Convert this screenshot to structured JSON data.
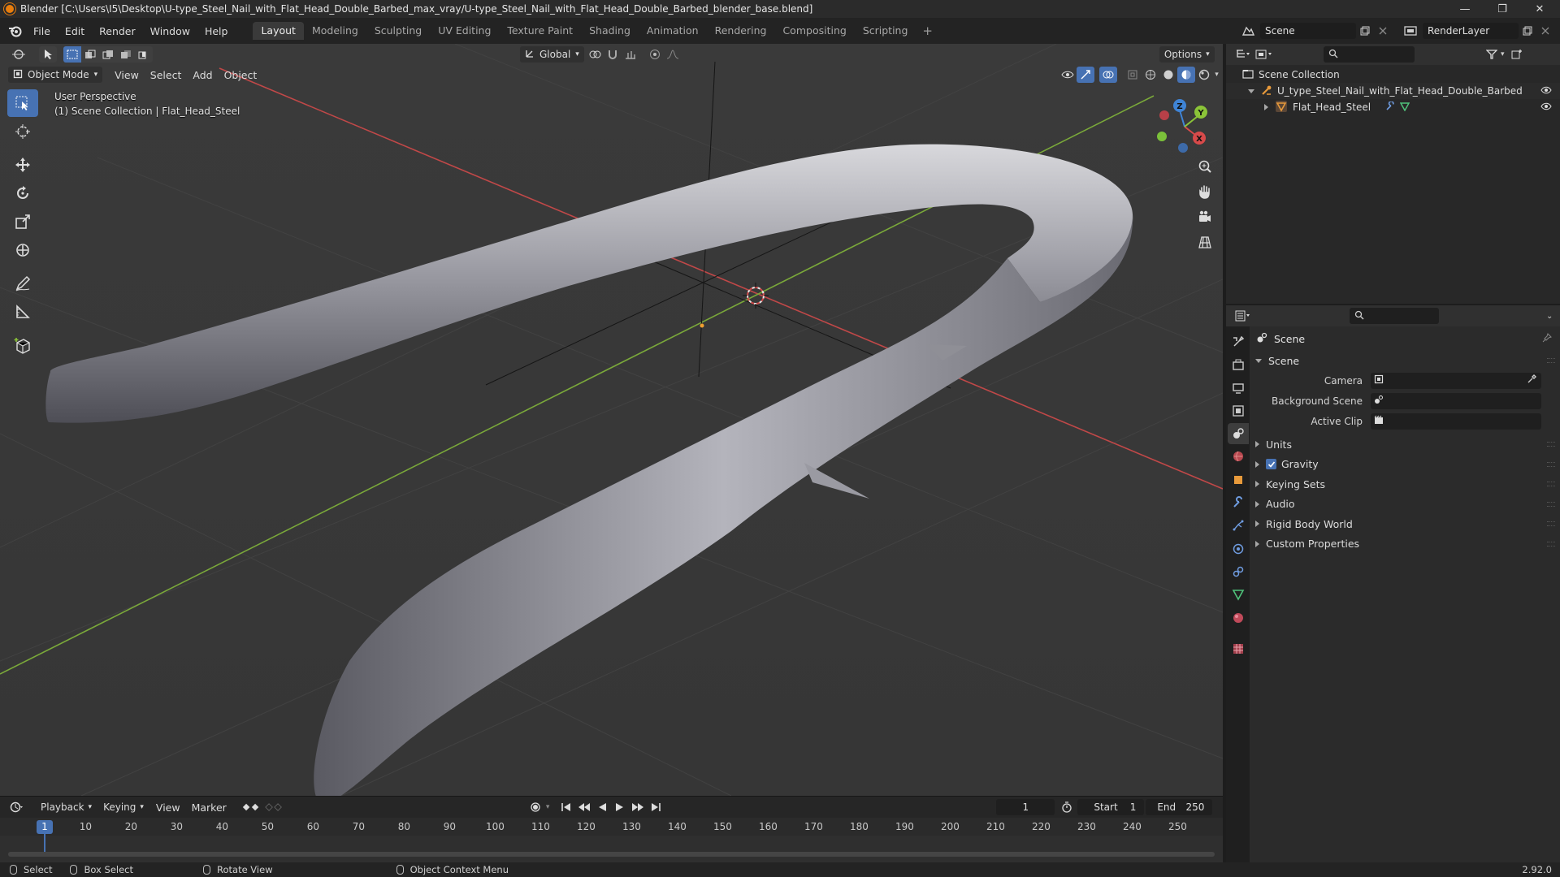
{
  "window": {
    "title": "Blender [C:\\Users\\I5\\Desktop\\U-type_Steel_Nail_with_Flat_Head_Double_Barbed_max_vray/U-type_Steel_Nail_with_Flat_Head_Double_Barbed_blender_base.blend]",
    "minimize": "—",
    "maximize": "❐",
    "close": "✕"
  },
  "menu": {
    "items": [
      "File",
      "Edit",
      "Render",
      "Window",
      "Help"
    ],
    "workspaces": [
      "Layout",
      "Modeling",
      "Sculpting",
      "UV Editing",
      "Texture Paint",
      "Shading",
      "Animation",
      "Rendering",
      "Compositing",
      "Scripting"
    ],
    "active_workspace": "Layout",
    "add_workspace": "+"
  },
  "scene_selector": {
    "scene_name": "Scene",
    "view_layer_name": "RenderLayer"
  },
  "viewport": {
    "transform_orientation": "Global",
    "options_label": "Options",
    "mode": "Object Mode",
    "header_menus": [
      "View",
      "Select",
      "Add",
      "Object"
    ],
    "info_line1": "User Perspective",
    "info_line2": "(1) Scene Collection | Flat_Head_Steel",
    "gizmo": {
      "x": "X",
      "y": "Y",
      "z": "Z"
    },
    "colors": {
      "x_axis": "#d84a4a",
      "y_axis": "#8bc438",
      "z_axis": "#3f84d6",
      "active_tool": "#4772b3"
    }
  },
  "outliner": {
    "root": "Scene Collection",
    "items": [
      {
        "name": "U_type_Steel_Nail_with_Flat_Head_Double_Barbed",
        "icon": "armature-icon"
      },
      {
        "name": "Flat_Head_Steel",
        "icon": "mesh-icon"
      }
    ]
  },
  "properties": {
    "context_title": "Scene",
    "panel_title": "Scene",
    "fields": [
      {
        "label": "Camera",
        "value": ""
      },
      {
        "label": "Background Scene",
        "value": ""
      },
      {
        "label": "Active Clip",
        "value": ""
      }
    ],
    "subpanels": [
      "Units",
      "Gravity",
      "Keying Sets",
      "Audio",
      "Rigid Body World",
      "Custom Properties"
    ],
    "gravity_enabled": true
  },
  "timeline": {
    "menus": [
      "Playback",
      "Keying",
      "View",
      "Marker"
    ],
    "current_frame": "1",
    "start_label": "Start",
    "start_value": "1",
    "end_label": "End",
    "end_value": "250",
    "ruler_ticks": [
      "1",
      "10",
      "20",
      "30",
      "40",
      "50",
      "60",
      "70",
      "80",
      "90",
      "100",
      "110",
      "120",
      "130",
      "140",
      "150",
      "160",
      "170",
      "180",
      "190",
      "200",
      "210",
      "220",
      "230",
      "240",
      "250"
    ]
  },
  "statusbar": {
    "items": [
      "Select",
      "Box Select",
      "Rotate View",
      "Object Context Menu"
    ],
    "version": "2.92.0"
  }
}
